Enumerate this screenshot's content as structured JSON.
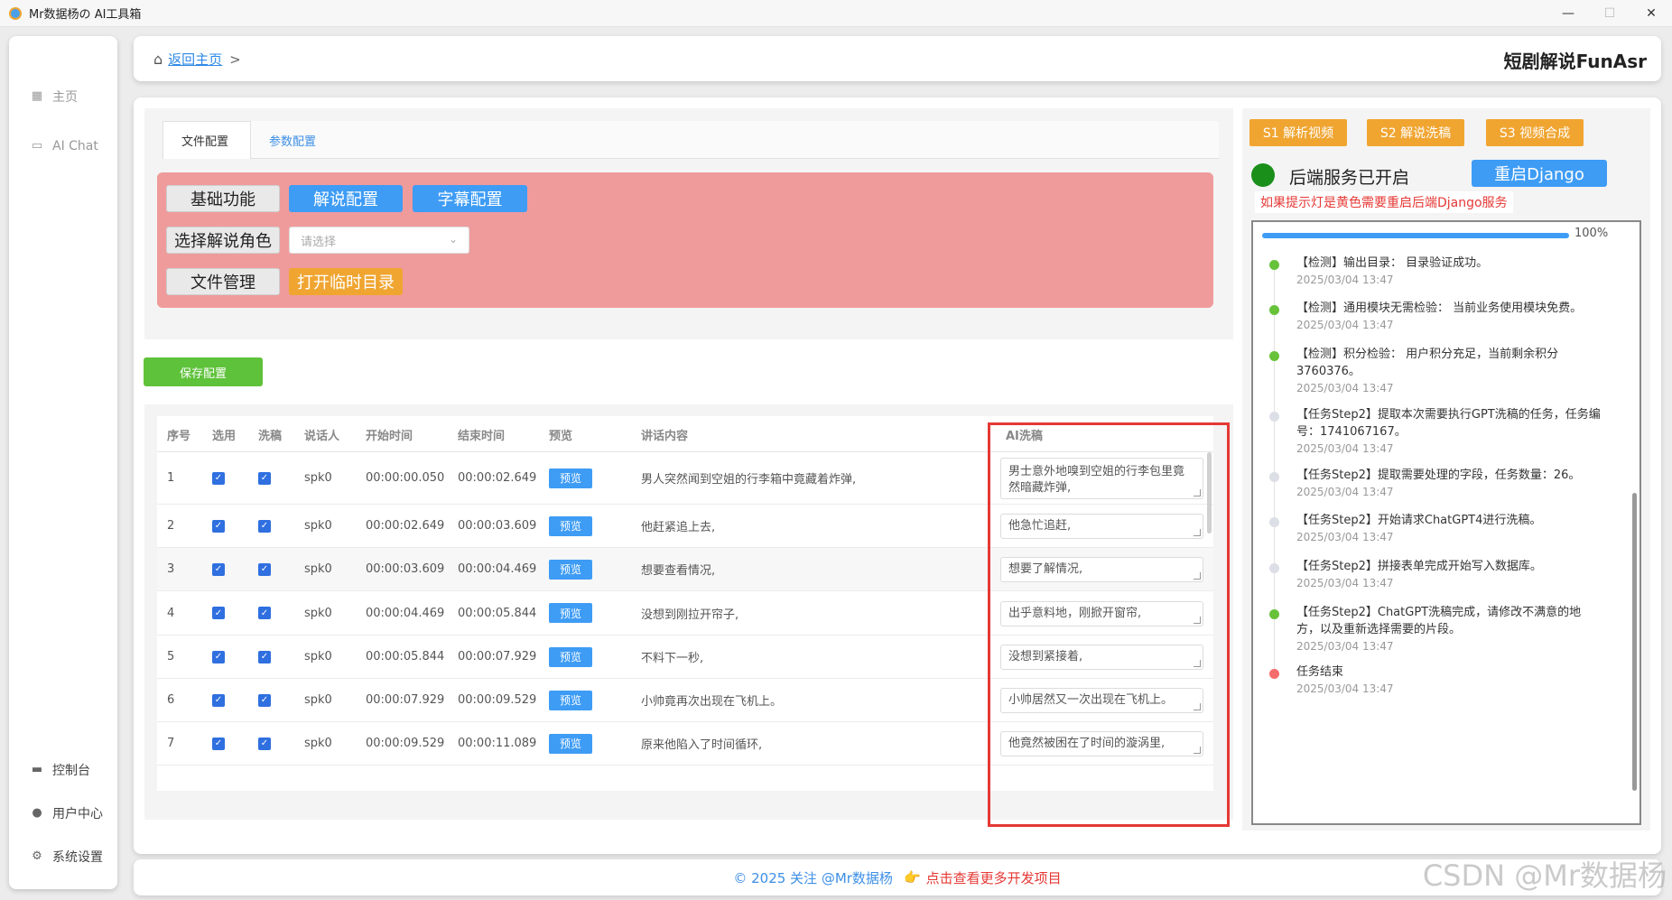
{
  "window": {
    "title": "Mr数据杨の AI工具箱"
  },
  "sidebar": {
    "top_items": [
      {
        "label": "主页",
        "icon": "grid-icon"
      },
      {
        "label": "AI Chat",
        "icon": "chat-icon"
      }
    ],
    "bottom_items": [
      {
        "label": "控制台",
        "icon": "monitor-icon"
      },
      {
        "label": "用户中心",
        "icon": "user-icon"
      },
      {
        "label": "系统设置",
        "icon": "gear-icon"
      }
    ]
  },
  "header": {
    "back_link": "返回主页",
    "separator": ">",
    "title": "短剧解说FunAsr"
  },
  "config": {
    "tabs": [
      "文件配置",
      "参数配置"
    ],
    "buttons": {
      "basic": "基础功能",
      "narration": "解说配置",
      "subtitle": "字幕配置",
      "choose_role": "选择解说角色",
      "file_mgmt": "文件管理",
      "open_temp": "打开临时目录"
    },
    "select_placeholder": "请选择",
    "save": "保存配置"
  },
  "table": {
    "headers": [
      "序号",
      "选用",
      "洗稿",
      "说话人",
      "开始时间",
      "结束时间",
      "预览",
      "讲话内容",
      "AI洗稿"
    ],
    "preview_label": "预览",
    "rows": [
      {
        "no": "1",
        "speaker": "spk0",
        "start": "00:00:00.050",
        "end": "00:00:02.649",
        "content": "男人突然闻到空姐的行李箱中竟藏着炸弹,",
        "ai": "男士意外地嗅到空姐的行李包里竟然暗藏炸弹,",
        "selected": true,
        "rewrite": true
      },
      {
        "no": "2",
        "speaker": "spk0",
        "start": "00:00:02.649",
        "end": "00:00:03.609",
        "content": "他赶紧追上去,",
        "ai": "他急忙追赶,",
        "selected": true,
        "rewrite": true
      },
      {
        "no": "3",
        "speaker": "spk0",
        "start": "00:00:03.609",
        "end": "00:00:04.469",
        "content": "想要查看情况,",
        "ai": "想要了解情况,",
        "selected": true,
        "rewrite": true
      },
      {
        "no": "4",
        "speaker": "spk0",
        "start": "00:00:04.469",
        "end": "00:00:05.844",
        "content": "没想到刚拉开帘子,",
        "ai": "出乎意料地，刚掀开窗帘,",
        "selected": true,
        "rewrite": true
      },
      {
        "no": "5",
        "speaker": "spk0",
        "start": "00:00:05.844",
        "end": "00:00:07.929",
        "content": "不料下一秒,",
        "ai": "没想到紧接着,",
        "selected": true,
        "rewrite": true
      },
      {
        "no": "6",
        "speaker": "spk0",
        "start": "00:00:07.929",
        "end": "00:00:09.529",
        "content": "小帅竟再次出现在飞机上。",
        "ai": "小帅居然又一次出现在飞机上。",
        "selected": true,
        "rewrite": true
      },
      {
        "no": "7",
        "speaker": "spk0",
        "start": "00:00:09.529",
        "end": "00:00:11.089",
        "content": "原来他陷入了时间循环,",
        "ai": "他竟然被困在了时间的漩涡里,",
        "selected": true,
        "rewrite": true
      }
    ]
  },
  "right": {
    "steps": [
      "S1 解析视频",
      "S2 解说洗稿",
      "S3 视频合成"
    ],
    "status": "后端服务已开启",
    "restart": "重启Django",
    "hint": "如果提示灯是黄色需要重启后端Django服务",
    "progress_percent": 100,
    "progress_label": "100%",
    "logs": [
      {
        "msg": "【检测】输出目录： 目录验证成功。",
        "time": "2025/03/04 13:47",
        "color": "#67c23a"
      },
      {
        "msg": "【检测】通用模块无需检验： 当前业务使用模块免费。",
        "time": "2025/03/04 13:47",
        "color": "#67c23a"
      },
      {
        "msg": "【检测】积分检验： 用户积分充足，当前剩余积分3760376。",
        "time": "2025/03/04 13:47",
        "color": "#67c23a"
      },
      {
        "msg": "【任务Step2】提取本次需要执行GPT洗稿的任务，任务编号：1741067167。",
        "time": "2025/03/04 13:47",
        "color": "#dcdfe6"
      },
      {
        "msg": "【任务Step2】提取需要处理的字段，任务数量：26。",
        "time": "2025/03/04 13:47",
        "color": "#dcdfe6"
      },
      {
        "msg": "【任务Step2】开始请求ChatGPT4进行洗稿。",
        "time": "2025/03/04 13:47",
        "color": "#dcdfe6"
      },
      {
        "msg": "【任务Step2】拼接表单完成开始写入数据库。",
        "time": "2025/03/04 13:47",
        "color": "#dcdfe6"
      },
      {
        "msg": "【任务Step2】ChatGPT洗稿完成，请修改不满意的地方，以及重新选择需要的片段。",
        "time": "2025/03/04 13:47",
        "color": "#67c23a"
      },
      {
        "msg": "任务结束",
        "time": "2025/03/04 13:47",
        "color": "#f56c6c"
      }
    ]
  },
  "footer": {
    "copyright": "© 2025 关注 @Mr数据杨",
    "emoji": "👉",
    "link": "点击查看更多开发项目"
  },
  "watermark": "CSDN @Mr数据杨"
}
